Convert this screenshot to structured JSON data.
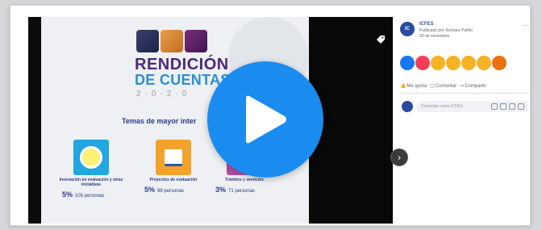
{
  "post": {
    "page_name": "ICFES",
    "published_by": "Publicado por Xiomara Patiño",
    "date": "20 de noviembre",
    "more": "···"
  },
  "slide": {
    "title_line1": "RENDICIÓN",
    "title_line2": "DE CUENTAS",
    "year": "2·0·2·0",
    "section_title": "Temas de mayor inter",
    "topics": [
      {
        "label": "Innovación en evaluación y otras iniciativas",
        "percent": "5%",
        "people": "105 personas"
      },
      {
        "label": "Proyectos de evaluación",
        "percent": "5%",
        "people": "98 personas"
      },
      {
        "label": "Trámites y servicios",
        "percent": "3%",
        "people": "71 personas"
      }
    ]
  },
  "video": {
    "play_icon": "play-icon",
    "next_icon": "›"
  },
  "actions": {
    "like": "Me gusta",
    "comment": "Comentar",
    "share": "Compartir"
  },
  "comment": {
    "placeholder": "Comentar como ICFES"
  },
  "colors": {
    "accent": "#1a8cf0",
    "fb_blue": "#385898"
  }
}
